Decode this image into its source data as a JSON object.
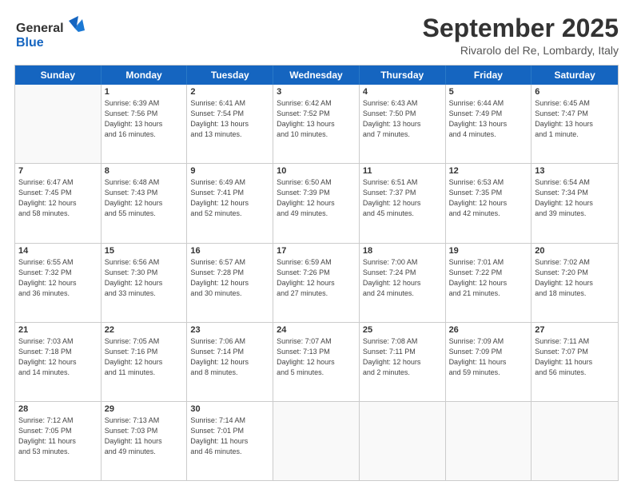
{
  "header": {
    "logo_general": "General",
    "logo_blue": "Blue",
    "month_title": "September 2025",
    "location": "Rivarolo del Re, Lombardy, Italy"
  },
  "calendar": {
    "days_of_week": [
      "Sunday",
      "Monday",
      "Tuesday",
      "Wednesday",
      "Thursday",
      "Friday",
      "Saturday"
    ],
    "weeks": [
      [
        {
          "day": "",
          "info": ""
        },
        {
          "day": "1",
          "info": "Sunrise: 6:39 AM\nSunset: 7:56 PM\nDaylight: 13 hours\nand 16 minutes."
        },
        {
          "day": "2",
          "info": "Sunrise: 6:41 AM\nSunset: 7:54 PM\nDaylight: 13 hours\nand 13 minutes."
        },
        {
          "day": "3",
          "info": "Sunrise: 6:42 AM\nSunset: 7:52 PM\nDaylight: 13 hours\nand 10 minutes."
        },
        {
          "day": "4",
          "info": "Sunrise: 6:43 AM\nSunset: 7:50 PM\nDaylight: 13 hours\nand 7 minutes."
        },
        {
          "day": "5",
          "info": "Sunrise: 6:44 AM\nSunset: 7:49 PM\nDaylight: 13 hours\nand 4 minutes."
        },
        {
          "day": "6",
          "info": "Sunrise: 6:45 AM\nSunset: 7:47 PM\nDaylight: 13 hours\nand 1 minute."
        }
      ],
      [
        {
          "day": "7",
          "info": "Sunrise: 6:47 AM\nSunset: 7:45 PM\nDaylight: 12 hours\nand 58 minutes."
        },
        {
          "day": "8",
          "info": "Sunrise: 6:48 AM\nSunset: 7:43 PM\nDaylight: 12 hours\nand 55 minutes."
        },
        {
          "day": "9",
          "info": "Sunrise: 6:49 AM\nSunset: 7:41 PM\nDaylight: 12 hours\nand 52 minutes."
        },
        {
          "day": "10",
          "info": "Sunrise: 6:50 AM\nSunset: 7:39 PM\nDaylight: 12 hours\nand 49 minutes."
        },
        {
          "day": "11",
          "info": "Sunrise: 6:51 AM\nSunset: 7:37 PM\nDaylight: 12 hours\nand 45 minutes."
        },
        {
          "day": "12",
          "info": "Sunrise: 6:53 AM\nSunset: 7:35 PM\nDaylight: 12 hours\nand 42 minutes."
        },
        {
          "day": "13",
          "info": "Sunrise: 6:54 AM\nSunset: 7:34 PM\nDaylight: 12 hours\nand 39 minutes."
        }
      ],
      [
        {
          "day": "14",
          "info": "Sunrise: 6:55 AM\nSunset: 7:32 PM\nDaylight: 12 hours\nand 36 minutes."
        },
        {
          "day": "15",
          "info": "Sunrise: 6:56 AM\nSunset: 7:30 PM\nDaylight: 12 hours\nand 33 minutes."
        },
        {
          "day": "16",
          "info": "Sunrise: 6:57 AM\nSunset: 7:28 PM\nDaylight: 12 hours\nand 30 minutes."
        },
        {
          "day": "17",
          "info": "Sunrise: 6:59 AM\nSunset: 7:26 PM\nDaylight: 12 hours\nand 27 minutes."
        },
        {
          "day": "18",
          "info": "Sunrise: 7:00 AM\nSunset: 7:24 PM\nDaylight: 12 hours\nand 24 minutes."
        },
        {
          "day": "19",
          "info": "Sunrise: 7:01 AM\nSunset: 7:22 PM\nDaylight: 12 hours\nand 21 minutes."
        },
        {
          "day": "20",
          "info": "Sunrise: 7:02 AM\nSunset: 7:20 PM\nDaylight: 12 hours\nand 18 minutes."
        }
      ],
      [
        {
          "day": "21",
          "info": "Sunrise: 7:03 AM\nSunset: 7:18 PM\nDaylight: 12 hours\nand 14 minutes."
        },
        {
          "day": "22",
          "info": "Sunrise: 7:05 AM\nSunset: 7:16 PM\nDaylight: 12 hours\nand 11 minutes."
        },
        {
          "day": "23",
          "info": "Sunrise: 7:06 AM\nSunset: 7:14 PM\nDaylight: 12 hours\nand 8 minutes."
        },
        {
          "day": "24",
          "info": "Sunrise: 7:07 AM\nSunset: 7:13 PM\nDaylight: 12 hours\nand 5 minutes."
        },
        {
          "day": "25",
          "info": "Sunrise: 7:08 AM\nSunset: 7:11 PM\nDaylight: 12 hours\nand 2 minutes."
        },
        {
          "day": "26",
          "info": "Sunrise: 7:09 AM\nSunset: 7:09 PM\nDaylight: 11 hours\nand 59 minutes."
        },
        {
          "day": "27",
          "info": "Sunrise: 7:11 AM\nSunset: 7:07 PM\nDaylight: 11 hours\nand 56 minutes."
        }
      ],
      [
        {
          "day": "28",
          "info": "Sunrise: 7:12 AM\nSunset: 7:05 PM\nDaylight: 11 hours\nand 53 minutes."
        },
        {
          "day": "29",
          "info": "Sunrise: 7:13 AM\nSunset: 7:03 PM\nDaylight: 11 hours\nand 49 minutes."
        },
        {
          "day": "30",
          "info": "Sunrise: 7:14 AM\nSunset: 7:01 PM\nDaylight: 11 hours\nand 46 minutes."
        },
        {
          "day": "",
          "info": ""
        },
        {
          "day": "",
          "info": ""
        },
        {
          "day": "",
          "info": ""
        },
        {
          "day": "",
          "info": ""
        }
      ]
    ]
  }
}
